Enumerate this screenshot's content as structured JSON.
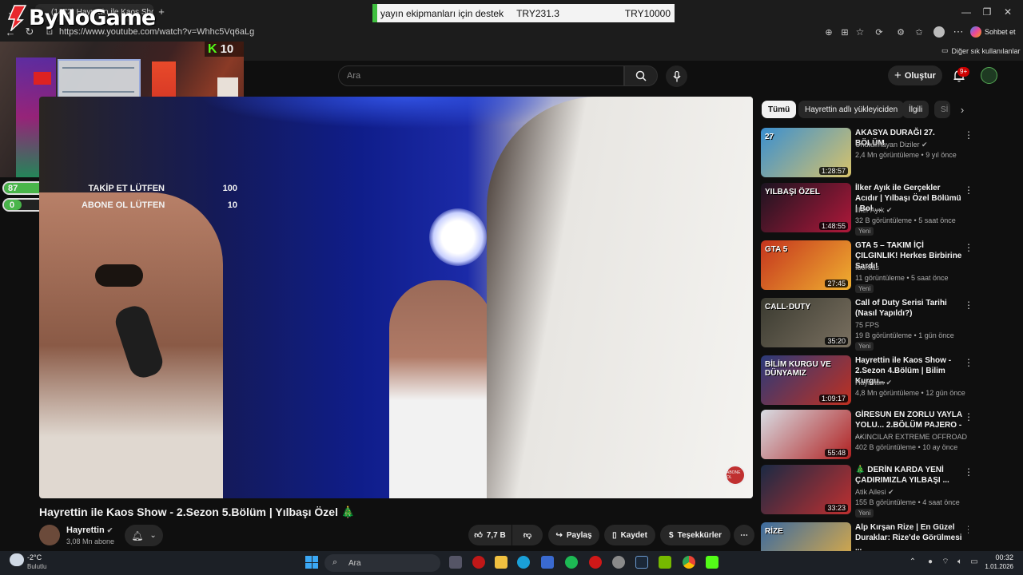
{
  "browser": {
    "tab_title": "(1472) Hayrettin ile Kaos Show...",
    "url": "https://www.youtube.com/watch?v=Whhc5Vq6aLg",
    "favorites_label": "Diğer sık kullanılanlar",
    "chat_label": "Sohbet et"
  },
  "overlay": {
    "logo_text": "ByNoGame",
    "donation": {
      "text": "yayın ekipmanları için destek",
      "current": "TRY231.3",
      "target": "TRY10000",
      "progress": 0.023
    },
    "kick_viewers": "10",
    "goals": [
      {
        "current": "87",
        "label": "TAKİP ET LÜTFEN",
        "target": "100",
        "progress": 0.87
      },
      {
        "current": "0",
        "label": "ABONE OL LÜTFEN",
        "target": "10",
        "progress": 0.0
      }
    ]
  },
  "youtube": {
    "search_placeholder": "Ara",
    "create_label": "Oluştur",
    "notifications_badge": "9+",
    "video": {
      "title": "Hayrettin ile Kaos Show - 2.Sezon 5.Bölüm | Yılbaşı Özel 🎄",
      "watermark": "ABONE OL",
      "channel": "Hayrettin",
      "subscribers": "3,08 Mn abone",
      "likes": "7,7 B",
      "share_label": "Paylaş",
      "save_label": "Kaydet",
      "thanks_label": "Teşekkürler"
    },
    "chips": [
      "Tümü",
      "Hayrettin adlı yükleyiciden",
      "İlgili",
      "Sİ"
    ],
    "recommendations": [
      {
        "title": "AKASYA DURAĞI 27. BÖLÜM",
        "channel": "Unutulmayan Diziler",
        "verified": true,
        "meta": "2,4 Mn görüntüleme • 9 yıl önce",
        "duration": "1:28:57",
        "badge": "",
        "thumb_text": "27",
        "colors": [
          "#3a8fd0",
          "#d8c36a"
        ]
      },
      {
        "title": "İlker Ayık ile Gerçekler Acıdır | Yılbaşı Özel Bölümü | Bol ...",
        "channel": "İlker Ayık",
        "verified": true,
        "meta": "32 B görüntüleme • 5 saat önce",
        "duration": "1:48:55",
        "badge": "Yeni",
        "thumb_text": "YILBAŞI ÖZEL",
        "colors": [
          "#1a1420",
          "#b0183a"
        ]
      },
      {
        "title": "GTA 5 – TAKIM İÇİ ÇILGINLIK! Herkes Birbirine Sardı!",
        "channel": "İboKlas",
        "verified": false,
        "meta": "11 görüntüleme • 5 saat önce",
        "duration": "27:45",
        "badge": "Yeni",
        "thumb_text": "GTA 5",
        "colors": [
          "#c4341e",
          "#f0b030"
        ]
      },
      {
        "title": "Call of Duty Serisi Tarihi (Nasıl Yapıldı?)",
        "channel": "75 FPS",
        "verified": false,
        "meta": "19 B görüntüleme • 1 gün önce",
        "duration": "35:20",
        "badge": "Yeni",
        "thumb_text": "CALL·DUTY",
        "colors": [
          "#3a3a30",
          "#7a7060"
        ]
      },
      {
        "title": "Hayrettin ile Kaos Show - 2.Sezon 4.Bölüm | Bilim Kurgu...",
        "channel": "Hayrettin",
        "verified": true,
        "meta": "4,8 Mn görüntüleme • 12 gün önce",
        "duration": "1:09:17",
        "badge": "",
        "thumb_text": "BİLİM KURGU VE DÜNYAMIZ",
        "colors": [
          "#2a3a7a",
          "#c03020"
        ]
      },
      {
        "title": "GİRESUN EN ZORLU YAYLA YOLU... 2.BÖLÜM PAJERO - ...",
        "channel": "AKINCILAR EXTREME OFFROAD",
        "verified": false,
        "meta": "402 B görüntüleme • 10 ay önce",
        "duration": "55:48",
        "badge": "",
        "thumb_text": "",
        "colors": [
          "#d8dde4",
          "#b02020"
        ]
      },
      {
        "title": "🎄 DERİN KARDA YENİ ÇADIRIMIZLA YILBAŞI ...",
        "channel": "Atik Ailesi",
        "verified": true,
        "meta": "155 B görüntüleme • 4 saat önce",
        "duration": "33:23",
        "badge": "Yeni",
        "thumb_text": "",
        "colors": [
          "#1a2a44",
          "#c03030"
        ]
      },
      {
        "title": "Alp Kırşan Rize | En Güzel Duraklar: Rize'de Görülmesi ...",
        "channel": "",
        "verified": false,
        "meta": "",
        "duration": "",
        "badge": "",
        "thumb_text": "RİZE",
        "colors": [
          "#3a6aa0",
          "#e8b040"
        ]
      }
    ]
  },
  "taskbar": {
    "weather_temp": "-2°C",
    "weather_desc": "Bulutlu",
    "search_placeholder": "Ara",
    "time": "00:32",
    "date": "1.01.2026"
  }
}
